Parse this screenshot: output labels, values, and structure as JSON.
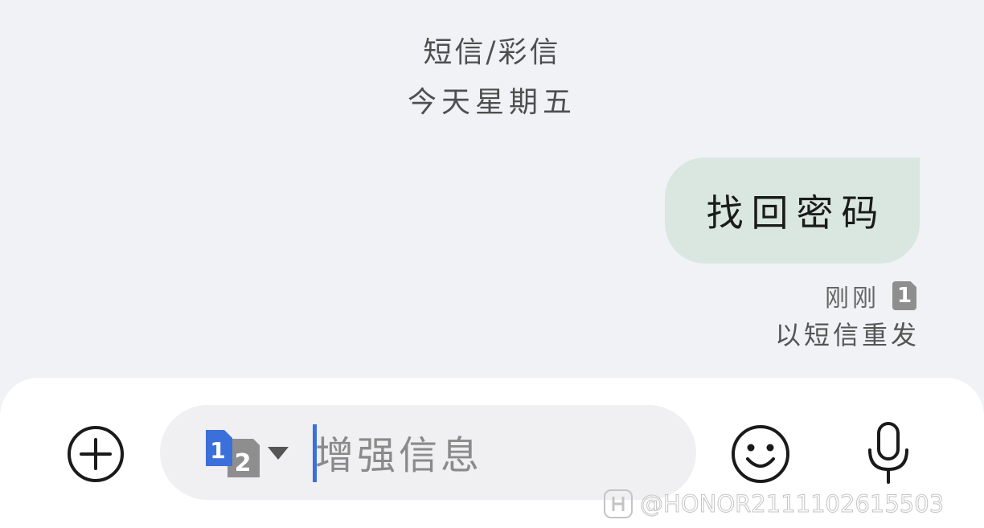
{
  "header": {
    "message_type": "短信/彩信",
    "date": "今天星期五"
  },
  "conversation": {
    "messages": [
      {
        "text": "找回密码",
        "direction": "outgoing",
        "time": "刚刚",
        "sim": "1",
        "status_action": "以短信重发"
      }
    ]
  },
  "composer": {
    "placeholder": "增强信息",
    "sim_primary": "1",
    "sim_secondary": "2",
    "icons": {
      "add": "plus-circle-icon",
      "sim": "dual-sim-icon",
      "dropdown": "caret-down-icon",
      "emoji": "smiley-icon",
      "mic": "microphone-icon"
    }
  },
  "watermark": {
    "text": "@HONOR2111102615503"
  },
  "colors": {
    "background": "#f1f2f6",
    "bubble": "#dae7e1",
    "accent": "#3b6fd9",
    "sim_primary": "#3b6fd9",
    "sim_secondary": "#8e8e8e"
  }
}
